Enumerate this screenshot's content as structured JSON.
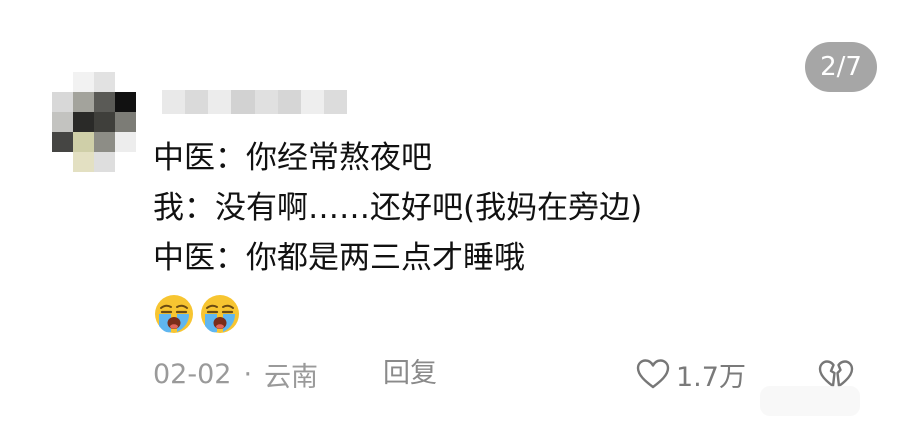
{
  "pager": {
    "label": "2/7"
  },
  "comment": {
    "lines": [
      "中医：你经常熬夜吧",
      "我：没有啊……还好吧(我妈在旁边)",
      "中医：你都是两三点才睡哦"
    ],
    "emojis": [
      "loudly-crying-face",
      "loudly-crying-face"
    ]
  },
  "meta": {
    "date": "02-02",
    "separator": "·",
    "location": "云南",
    "reply_label": "回复"
  },
  "actions": {
    "like_count": "1.7万",
    "like_icon": "heart-outline-icon",
    "dislike_icon": "broken-heart-outline-icon"
  },
  "colors": {
    "badge_bg": "#a6a6a6",
    "meta_text": "#9a9a9a",
    "body_text": "#111111"
  }
}
